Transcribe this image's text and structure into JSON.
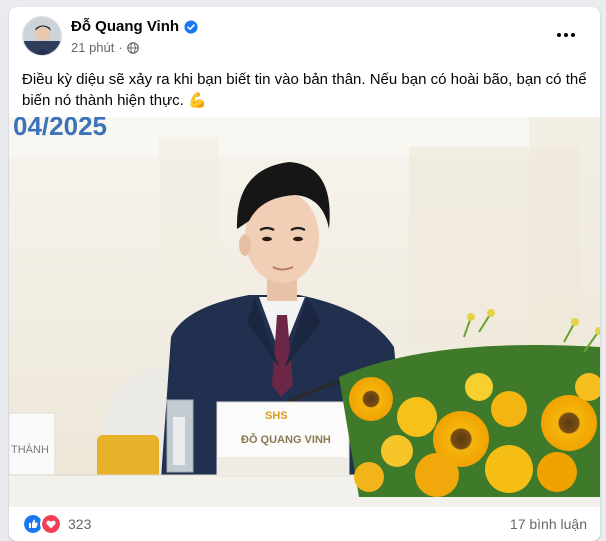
{
  "post": {
    "author": "Đỗ Quang Vinh",
    "time": "21 phút",
    "separator": "·",
    "text": "Điều kỳ diệu sẽ xảy ra khi bạn biết tin vào bản thân. Nếu bạn có hoài bão, bạn có thể biến nó thành hiện thực. 💪",
    "privacy_icon": "globe-icon",
    "verified_icon": "verified-badge-icon"
  },
  "photo": {
    "backdrop_date": "04/2025",
    "nameplate_logo": "SHS",
    "nameplate_name": "ĐỖ QUANG VINH",
    "side_card_text": "THÀNH"
  },
  "footer": {
    "reaction_icons": [
      "like-icon",
      "love-icon"
    ],
    "reaction_count": "323",
    "comment_count": "17 bình luận"
  },
  "colors": {
    "brand_blue": "#1877f2",
    "love_red": "#f33e58",
    "text_secondary": "#65676b"
  }
}
